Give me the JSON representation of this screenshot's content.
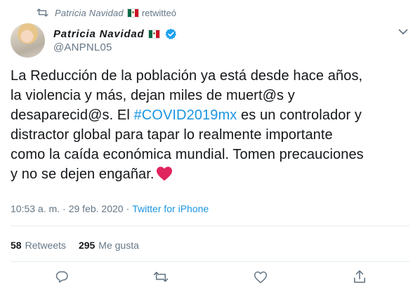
{
  "retweet_bar": {
    "icon": "retweet-icon",
    "name": "Patricia Navidad",
    "flag": "mexico-flag-emoji",
    "label": "retwitteó"
  },
  "author": {
    "name": "Patricia Navidad",
    "flag": "mexico-flag-emoji",
    "verified": true,
    "handle": "@ANPNL05"
  },
  "tweet": {
    "lines": [
      "La Reducción de la población ya está desde hace años,",
      "la violencia y más, dejan miles de muert@s y",
      "desaparecid@s. El ",
      " es un controlador y",
      "distractor global para tapar lo realmente importante",
      "como la caída económica mundial. Tomen precauciones",
      "y no se dejen engañar."
    ],
    "hashtag": "#COVID2019mx",
    "emoji": "red-heart"
  },
  "meta": {
    "time": "10:53 a. m.",
    "separator": "·",
    "date": "29 feb. 2020",
    "source": "Twitter for iPhone"
  },
  "stats": {
    "retweets_count": "58",
    "retweets_label": "Retweets",
    "likes_count": "295",
    "likes_label": "Me gusta"
  },
  "actions": [
    "reply-icon",
    "retweet-icon",
    "like-icon",
    "share-icon"
  ],
  "colors": {
    "link": "#1b95e0",
    "secondary_text": "#657786",
    "primary_text": "#14171a",
    "heart": "#e0245e",
    "divider": "#e6ecf0"
  }
}
